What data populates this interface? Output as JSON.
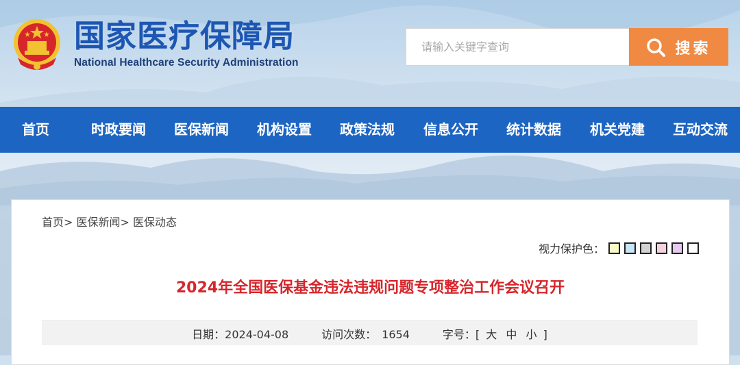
{
  "header": {
    "logo_cn": "国家医疗保障局",
    "logo_en": "National Healthcare Security Administration"
  },
  "search": {
    "placeholder": "请输入关键字查询",
    "button_label": "搜索",
    "button_color": "#f08a43"
  },
  "nav": {
    "color": "#1c65c2",
    "items": [
      "首页",
      "时政要闻",
      "医保新闻",
      "机构设置",
      "政策法规",
      "信息公开",
      "统计数据",
      "机关党建",
      "互动交流"
    ]
  },
  "breadcrumb": {
    "items": [
      "首页",
      "医保新闻",
      "医保动态"
    ],
    "separator": ">"
  },
  "eye_protection": {
    "label": "视力保护色：",
    "swatches": [
      "#fafac8",
      "#c8e6f5",
      "#d2d2d2",
      "#f5d2dc",
      "#e6c8f0",
      "#ffffff"
    ]
  },
  "article": {
    "title": "2024年全国医保基金违法违规问题专项整治工作会议召开",
    "title_color": "#d6262b",
    "date_label": "日期：",
    "date": "2024-04-08",
    "visits_label": "访问次数：",
    "visits": "1654",
    "font_size_label": "字号：",
    "font_size_open": "[",
    "font_sizes": [
      "大",
      "中",
      "小"
    ],
    "font_size_close": "]"
  }
}
